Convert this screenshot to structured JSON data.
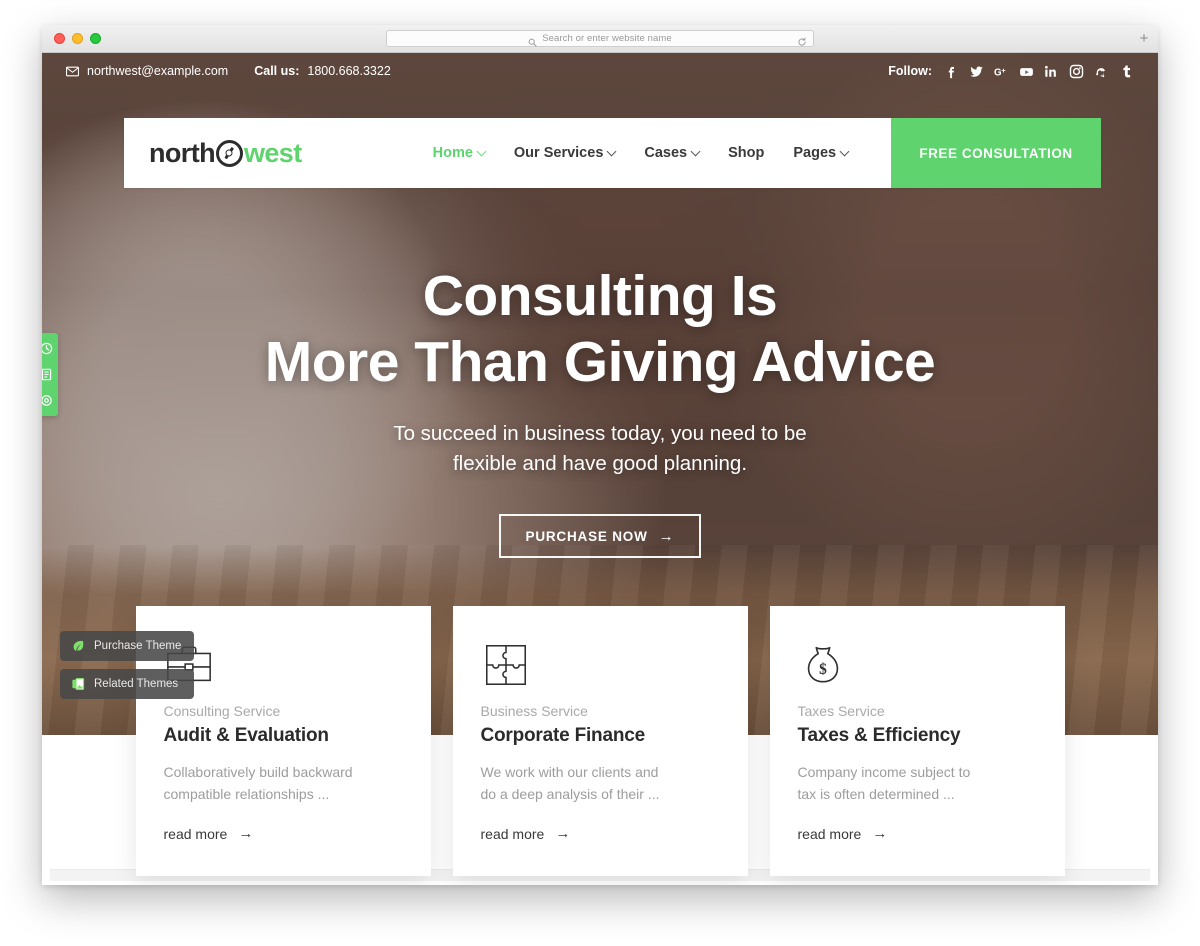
{
  "browser": {
    "url_placeholder": "Search or enter website name",
    "search_icon": "search-icon",
    "reload_icon": "reload-icon",
    "new_tab_label": "+"
  },
  "topbar": {
    "email_icon": "envelope-icon",
    "email": "northwest@example.com",
    "call_label": "Call us:",
    "phone": "1800.668.3322",
    "follow_label": "Follow:",
    "social": [
      {
        "name": "facebook-icon",
        "glyph": "f"
      },
      {
        "name": "twitter-icon",
        "glyph": "t"
      },
      {
        "name": "google-plus-icon",
        "glyph": "G+"
      },
      {
        "name": "youtube-icon",
        "glyph": "yt"
      },
      {
        "name": "linkedin-icon",
        "glyph": "in"
      },
      {
        "name": "instagram-icon",
        "glyph": "ig"
      },
      {
        "name": "stumbleupon-icon",
        "glyph": "su"
      },
      {
        "name": "tumblr-icon",
        "glyph": "t"
      }
    ]
  },
  "header": {
    "logo": {
      "first": "north",
      "icon": "compass-icon",
      "second": "west"
    },
    "nav": [
      {
        "label": "Home",
        "has_caret": true,
        "active": true
      },
      {
        "label": "Our Services",
        "has_caret": true,
        "active": false
      },
      {
        "label": "Cases",
        "has_caret": true,
        "active": false
      },
      {
        "label": "Shop",
        "has_caret": false,
        "active": false
      },
      {
        "label": "Pages",
        "has_caret": true,
        "active": false
      }
    ],
    "cta_label": "FREE CONSULTATION",
    "accent_color": "#5fd36e"
  },
  "hero": {
    "title_line1": "Consulting Is",
    "title_line2": "More Than Giving Advice",
    "subtitle_line1": "To succeed in business today, you need to be",
    "subtitle_line2": "flexible and have good planning.",
    "button_label": "PURCHASE NOW",
    "button_arrow": "→"
  },
  "cards": [
    {
      "icon": "briefcase-icon",
      "eyebrow": "Consulting Service",
      "title": "Audit & Evaluation",
      "desc_line1": "Collaboratively build backward",
      "desc_line2": "compatible relationships ...",
      "more_label": "read more",
      "more_arrow": "→"
    },
    {
      "icon": "puzzle-piece-icon",
      "eyebrow": "Business Service",
      "title": "Corporate Finance",
      "desc_line1": "We work with our clients and",
      "desc_line2": "do a deep analysis of their ...",
      "more_label": "read more",
      "more_arrow": "→"
    },
    {
      "icon": "money-bag-icon",
      "eyebrow": "Taxes Service",
      "title": "Taxes & Efficiency",
      "desc_line1": "Company income subject to",
      "desc_line2": "tax is often determined ...",
      "more_label": "read more",
      "more_arrow": "→"
    }
  ],
  "side_tab": {
    "color": "#5fd36e",
    "items": [
      {
        "name": "clock-icon"
      },
      {
        "name": "document-icon"
      },
      {
        "name": "gear-icon"
      }
    ]
  },
  "float_buttons": [
    {
      "icon": "leaf-icon",
      "label": "Purchase Theme"
    },
    {
      "icon": "themes-icon",
      "label": "Related Themes"
    }
  ]
}
